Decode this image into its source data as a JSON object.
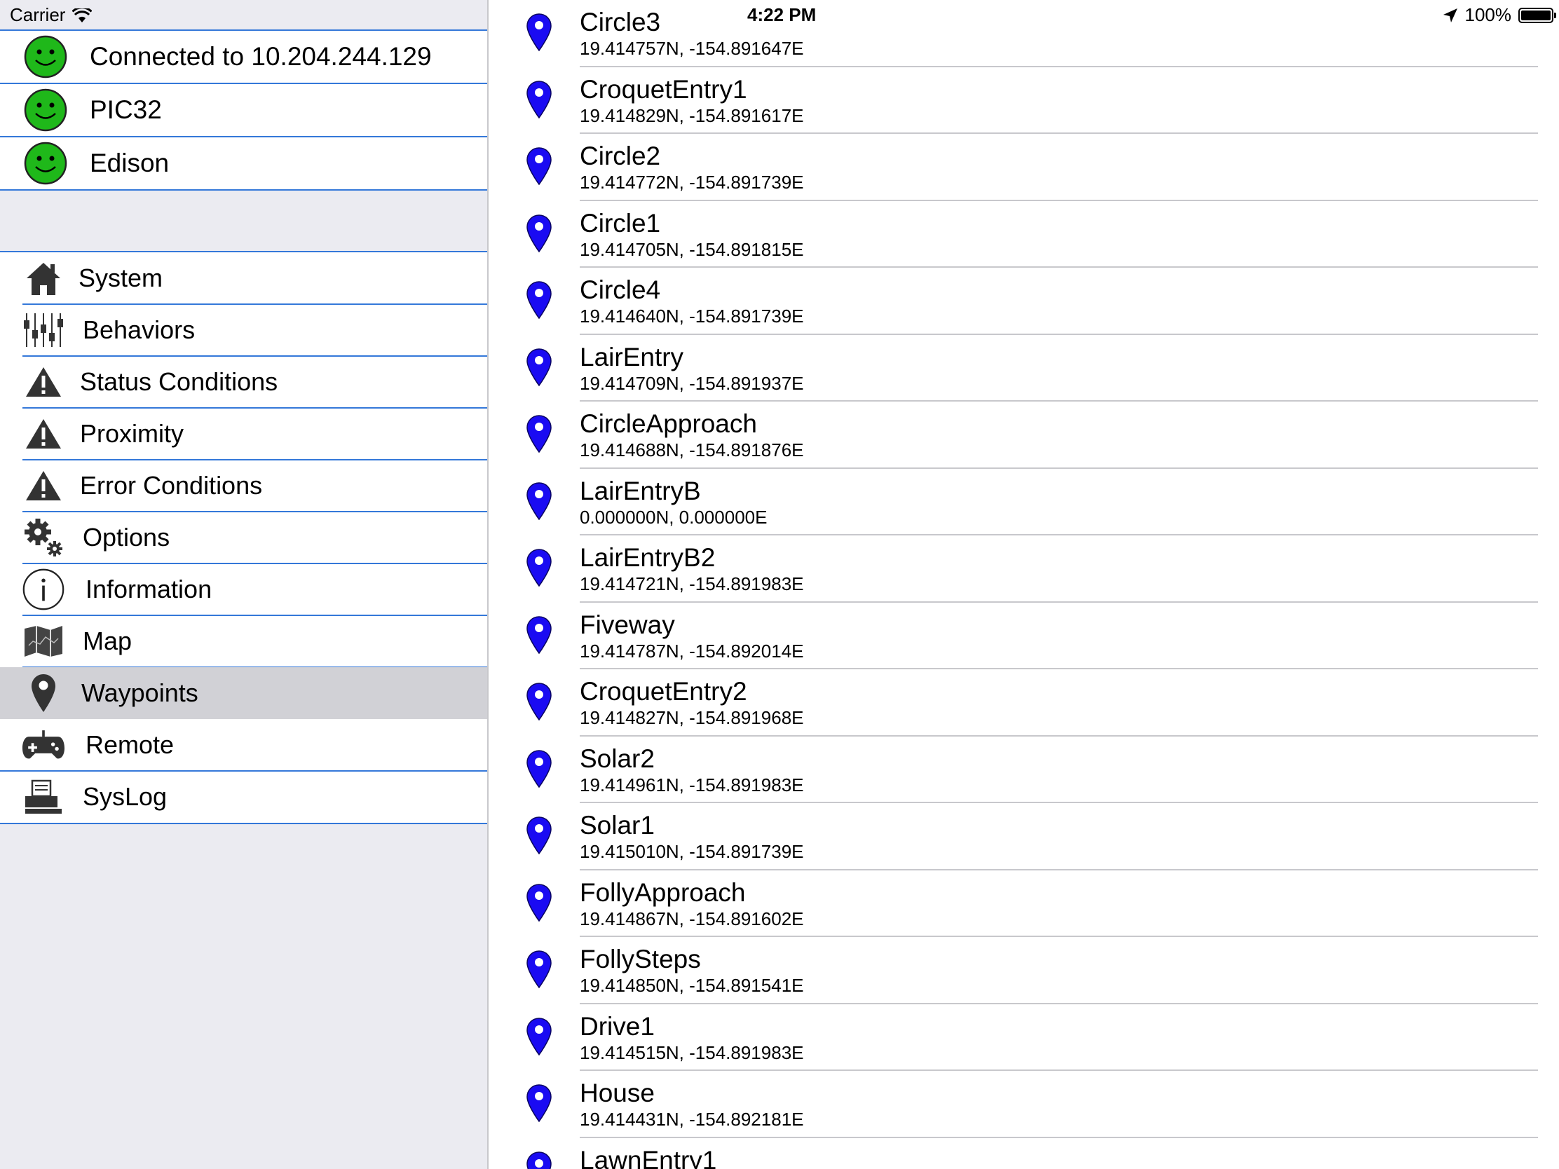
{
  "status_bar": {
    "carrier": "Carrier",
    "time": "4:22 PM",
    "battery": "100%",
    "battery_level": 1.0
  },
  "connections": [
    {
      "label": "Connected to 10.204.244.129",
      "icon": "smiley-green-icon"
    },
    {
      "label": "PIC32",
      "icon": "smiley-green-icon"
    },
    {
      "label": "Edison",
      "icon": "smiley-green-icon"
    }
  ],
  "menu": [
    {
      "label": "System",
      "icon": "house-icon"
    },
    {
      "label": "Behaviors",
      "icon": "sliders-icon"
    },
    {
      "label": "Status Conditions",
      "icon": "warning-icon"
    },
    {
      "label": "Proximity",
      "icon": "warning-icon"
    },
    {
      "label": "Error Conditions",
      "icon": "warning-icon"
    },
    {
      "label": "Options",
      "icon": "gears-icon"
    },
    {
      "label": "Information",
      "icon": "info-icon"
    },
    {
      "label": "Map",
      "icon": "map-icon"
    },
    {
      "label": "Waypoints",
      "icon": "pin-icon",
      "selected": true
    },
    {
      "label": "Remote",
      "icon": "gamepad-icon"
    },
    {
      "label": "SysLog",
      "icon": "printer-icon"
    }
  ],
  "waypoints": [
    {
      "name": "Circle3",
      "coord": "19.414757N, -154.891647E"
    },
    {
      "name": "CroquetEntry1",
      "coord": "19.414829N, -154.891617E"
    },
    {
      "name": "Circle2",
      "coord": "19.414772N, -154.891739E"
    },
    {
      "name": "Circle1",
      "coord": "19.414705N, -154.891815E"
    },
    {
      "name": "Circle4",
      "coord": "19.414640N, -154.891739E"
    },
    {
      "name": "LairEntry",
      "coord": "19.414709N, -154.891937E"
    },
    {
      "name": "CircleApproach",
      "coord": "19.414688N, -154.891876E"
    },
    {
      "name": "LairEntryB",
      "coord": "0.000000N, 0.000000E"
    },
    {
      "name": "LairEntryB2",
      "coord": "19.414721N, -154.891983E"
    },
    {
      "name": "Fiveway",
      "coord": "19.414787N, -154.892014E"
    },
    {
      "name": "CroquetEntry2",
      "coord": "19.414827N, -154.891968E"
    },
    {
      "name": "Solar2",
      "coord": "19.414961N, -154.891983E"
    },
    {
      "name": "Solar1",
      "coord": "19.415010N, -154.891739E"
    },
    {
      "name": "FollyApproach",
      "coord": "19.414867N, -154.891602E"
    },
    {
      "name": "FollySteps",
      "coord": "19.414850N, -154.891541E"
    },
    {
      "name": "Drive1",
      "coord": "19.414515N, -154.891983E"
    },
    {
      "name": "House",
      "coord": "19.414431N, -154.892181E"
    },
    {
      "name": "LawnEntry1",
      "coord": ""
    }
  ],
  "colors": {
    "accent_blue": "#3478d9",
    "pin_blue": "#1a0bf2",
    "smiley_green": "#1fb81a",
    "selected_gray": "#d1d1d6",
    "sidebar_bg": "#ebebf1"
  }
}
